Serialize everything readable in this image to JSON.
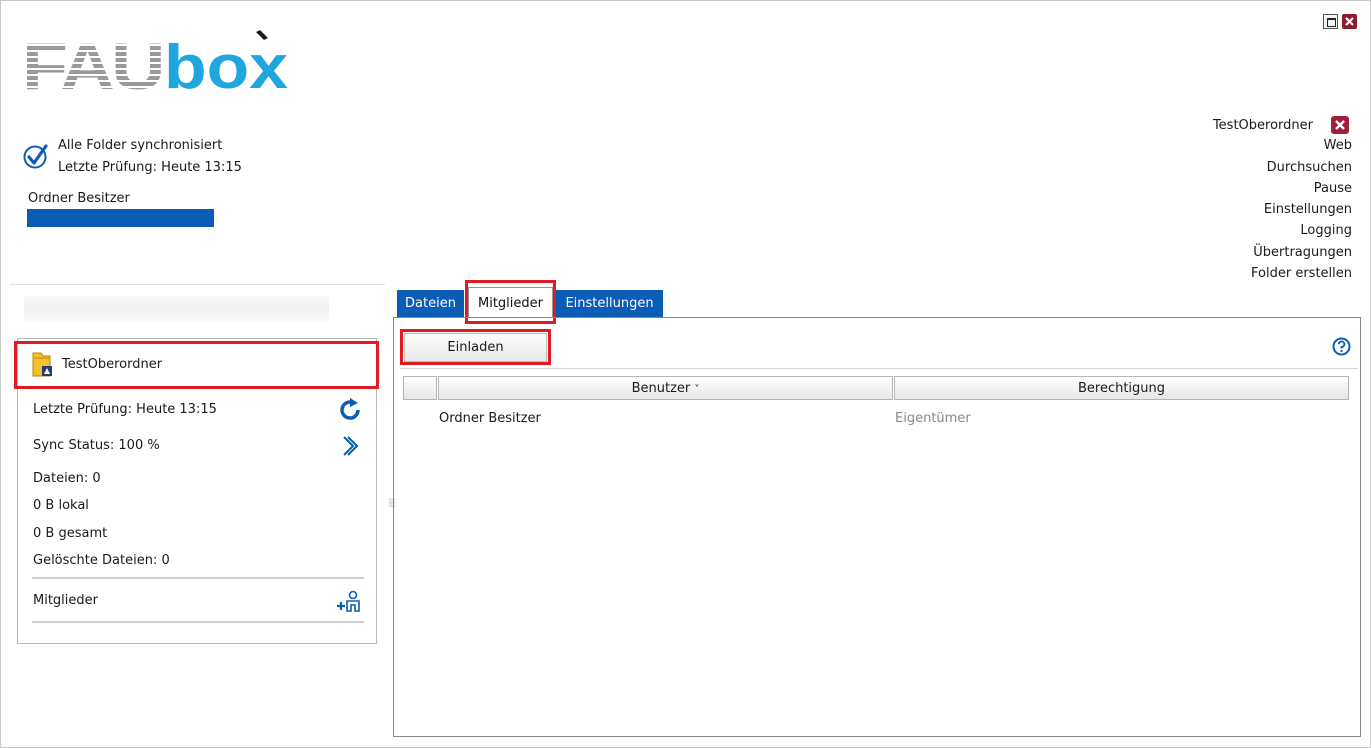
{
  "app": {
    "logo_text_left": "FAU",
    "logo_text_right": "box"
  },
  "status": {
    "line1": "Alle Folder synchronisiert",
    "line2": "Letzte Prüfung: Heute 13:15",
    "owner_label": "Ordner Besitzer"
  },
  "menu": {
    "active_folder": "TestOberordner",
    "items": [
      "Web",
      "Durchsuchen",
      "Pause",
      "Einstellungen",
      "Logging",
      "Übertragungen",
      "Folder erstellen"
    ]
  },
  "folder": {
    "name": "TestOberordner",
    "last_check": "Letzte Prüfung: Heute 13:15",
    "sync_status": "Sync Status: 100 %",
    "files": "Dateien: 0",
    "local": "0 B lokal",
    "total": "0 B gesamt",
    "deleted": "Gelöschte Dateien: 0",
    "members": "Mitglieder"
  },
  "tabs": [
    "Dateien",
    "Mitglieder",
    "Einstellungen"
  ],
  "members_view": {
    "invite_label": "Einladen",
    "columns": [
      "Benutzer",
      "Berechtigung"
    ],
    "rows": [
      {
        "user": "Ordner Besitzer",
        "permission": "Eigentümer"
      }
    ]
  },
  "colors": {
    "accent": "#0a5cb5",
    "highlight": "#e01b24",
    "close": "#8c1c2c"
  }
}
